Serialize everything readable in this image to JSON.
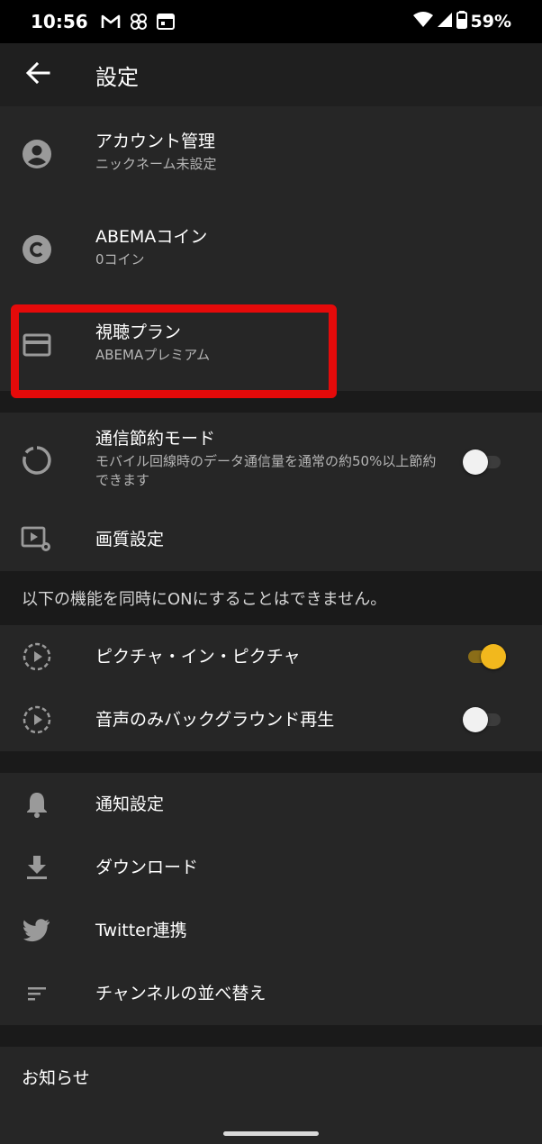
{
  "status_bar": {
    "time": "10:56",
    "left_icons": [
      "gmail-icon",
      "pinwheel-icon",
      "calendar-icon"
    ],
    "right_icons": [
      "wifi-icon",
      "signal-icon",
      "battery-icon"
    ],
    "battery": "59%"
  },
  "app_bar": {
    "title": "設定",
    "back_icon": "arrow-left-icon"
  },
  "account_section": [
    {
      "icon": "account-circle-icon",
      "title": "アカウント管理",
      "sub": "ニックネーム未設定"
    },
    {
      "icon": "coin-icon",
      "title": "ABEMAコイン",
      "sub": "0コイン"
    },
    {
      "icon": "credit-card-icon",
      "title": "視聴プラン",
      "sub": "ABEMAプレミアム"
    }
  ],
  "playback_section": [
    {
      "icon": "data-saver-icon",
      "title": "通信節約モード",
      "sub": "モバイル回線時のデータ通信量を通常の約50%以上節約できます",
      "toggle": false
    },
    {
      "icon": "video-settings-icon",
      "title": "画質設定"
    }
  ],
  "notice": "以下の機能を同時にONにすることはできません。",
  "exclusive_section": [
    {
      "icon": "picture-in-picture-icon",
      "title": "ピクチャ・イン・ピクチャ",
      "toggle": true
    },
    {
      "icon": "background-play-icon",
      "title": "音声のみバックグラウンド再生",
      "toggle": false
    }
  ],
  "misc_section": [
    {
      "icon": "bell-icon",
      "title": "通知設定"
    },
    {
      "icon": "download-icon",
      "title": "ダウンロード"
    },
    {
      "icon": "twitter-icon",
      "title": "Twitter連携"
    },
    {
      "icon": "sort-icon",
      "title": "チャンネルの並べ替え"
    }
  ],
  "info_section": {
    "title": "お知らせ"
  },
  "colors": {
    "highlight": "#e50a0a",
    "toggle_on": "#f2b81d",
    "background": "#1a1a1a",
    "section": "#262626"
  }
}
